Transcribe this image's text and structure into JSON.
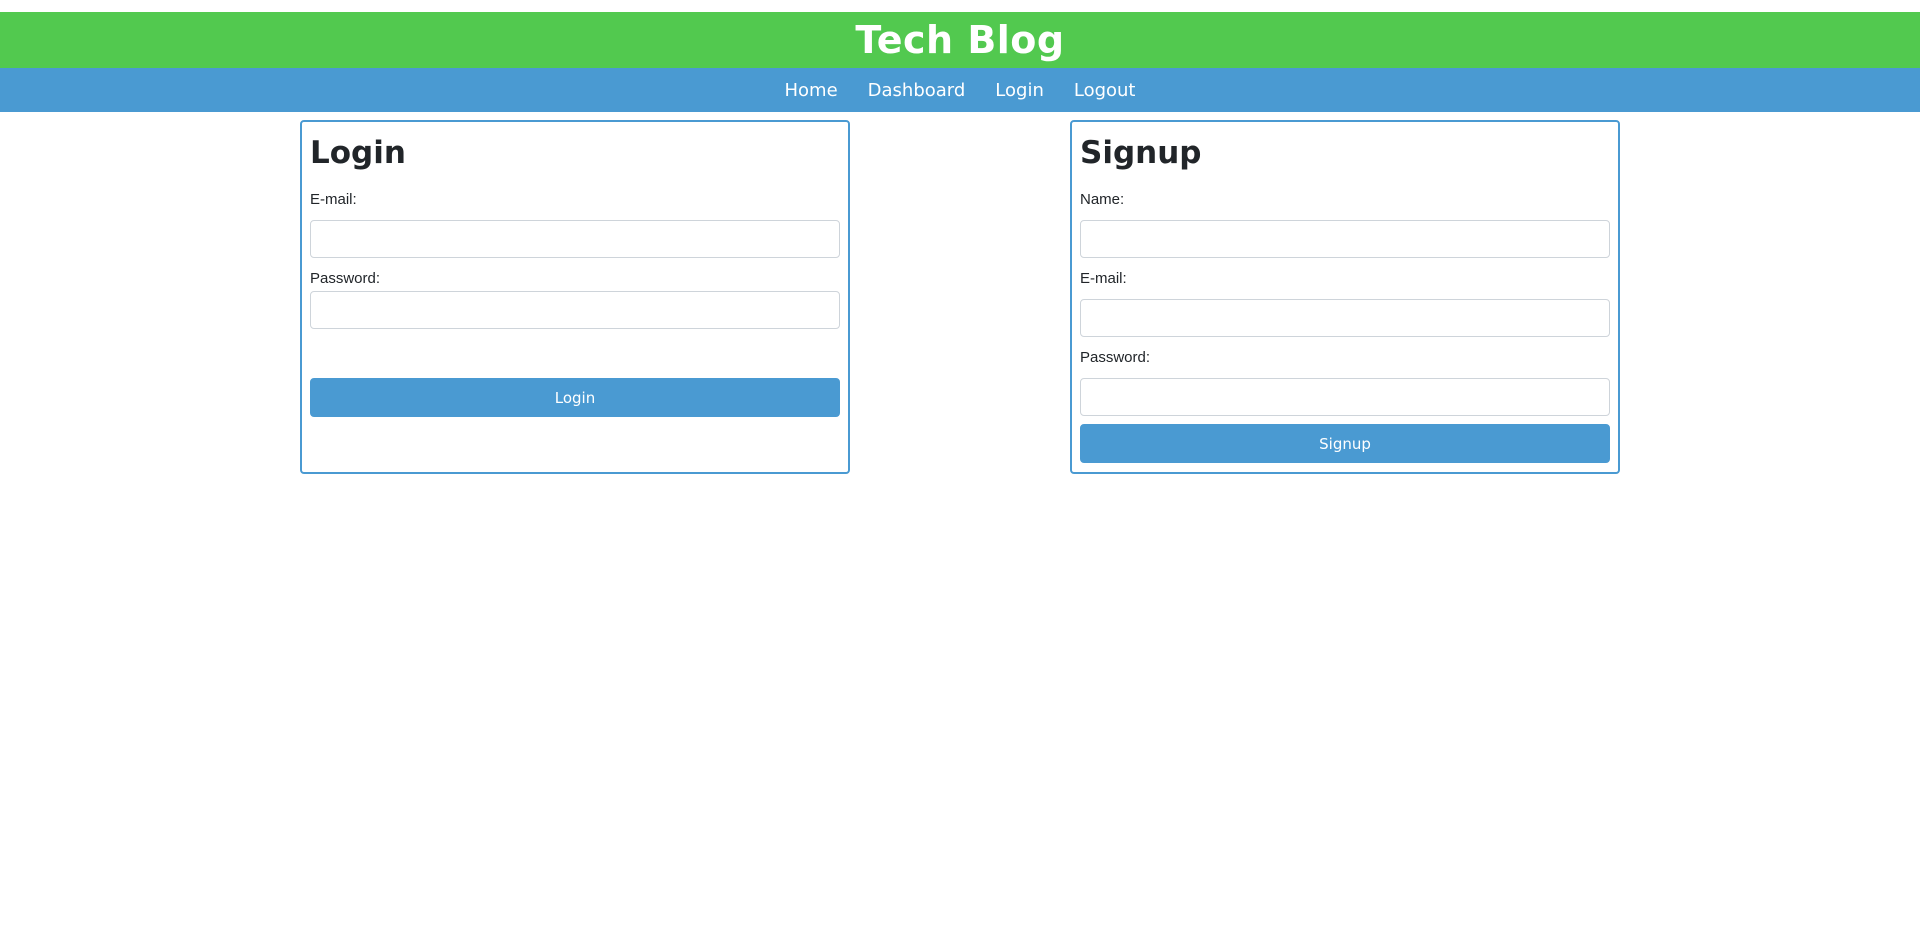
{
  "header": {
    "title": "Tech Blog",
    "background_color": "#52c94f"
  },
  "nav": {
    "background_color": "#4a9ad2",
    "items": [
      {
        "label": "Home"
      },
      {
        "label": "Dashboard"
      },
      {
        "label": "Login"
      },
      {
        "label": "Logout"
      }
    ]
  },
  "login": {
    "title": "Login",
    "email_label": "E-mail:",
    "email_value": "",
    "password_label": "Password:",
    "password_value": "",
    "submit_label": "Login"
  },
  "signup": {
    "title": "Signup",
    "name_label": "Name:",
    "name_value": "",
    "email_label": "E-mail:",
    "email_value": "",
    "password_label": "Password:",
    "password_value": "",
    "submit_label": "Signup"
  },
  "colors": {
    "accent": "#4a9ad2",
    "brand": "#52c94f"
  }
}
